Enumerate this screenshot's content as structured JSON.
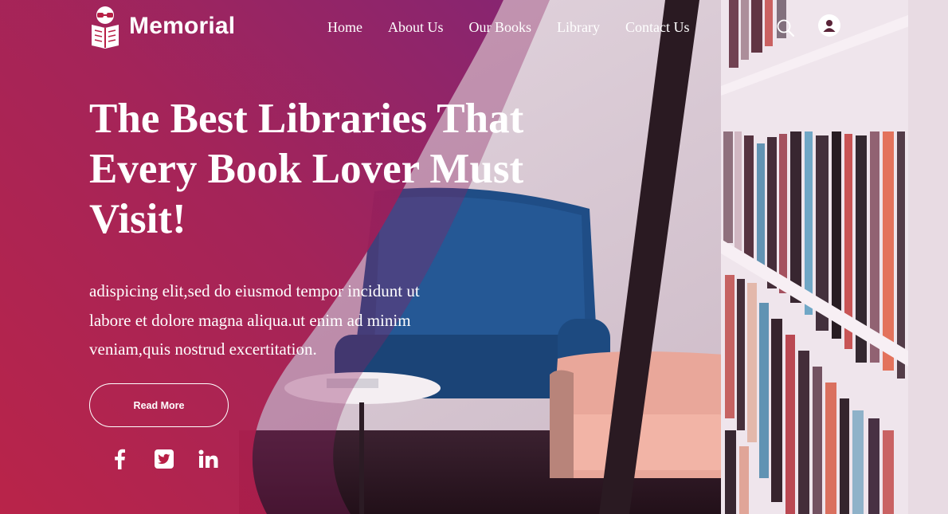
{
  "brand": {
    "name": "Memorial",
    "logo_icon": "reader-book-logo-icon"
  },
  "nav": {
    "items": [
      {
        "label": "Home"
      },
      {
        "label": "About Us"
      },
      {
        "label": "Our Books"
      },
      {
        "label": "Library"
      },
      {
        "label": "Contact Us"
      }
    ]
  },
  "header_icons": {
    "search": "search-icon",
    "user": "user-icon"
  },
  "hero": {
    "title_lines": [
      "The Best Libraries That",
      "Every Book Lover Must",
      "Visit!"
    ],
    "text_lines": [
      "adispicing elit,sed do eiusmod tempor incidunt ut",
      "labore et dolore magna aliqua.ut enim ad minim",
      "veniam,quis nostrud excertitation."
    ],
    "button_label": "Read More"
  },
  "social": [
    {
      "name": "facebook-icon"
    },
    {
      "name": "twitter-icon"
    },
    {
      "name": "linkedin-icon"
    }
  ],
  "colors": {
    "overlay_start": "#b81f45",
    "overlay_end": "#8a226a",
    "text": "#ffffff"
  }
}
